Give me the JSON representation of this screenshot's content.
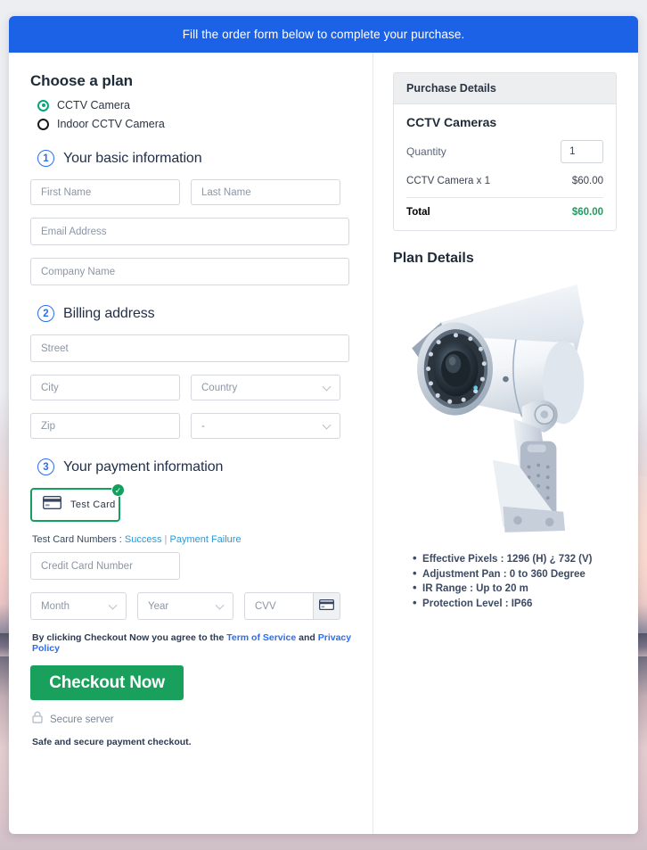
{
  "banner": {
    "text": "Fill the order form below to complete your purchase."
  },
  "plan": {
    "heading": "Choose a plan",
    "options": [
      {
        "label": "CCTV Camera",
        "selected": true
      },
      {
        "label": "Indoor CCTV Camera",
        "selected": false
      }
    ]
  },
  "steps": {
    "basic": {
      "number": "1",
      "title": "Your basic information"
    },
    "billing": {
      "number": "2",
      "title": "Billing address"
    },
    "payment": {
      "number": "3",
      "title": "Your payment information"
    }
  },
  "fields": {
    "first_name": {
      "placeholder": "First Name",
      "value": ""
    },
    "last_name": {
      "placeholder": "Last Name",
      "value": ""
    },
    "email": {
      "placeholder": "Email Address",
      "value": ""
    },
    "company": {
      "placeholder": "Company Name",
      "value": ""
    },
    "street": {
      "placeholder": "Street",
      "value": ""
    },
    "city": {
      "placeholder": "City",
      "value": ""
    },
    "country": {
      "placeholder": "Country",
      "value": ""
    },
    "zip": {
      "placeholder": "Zip",
      "value": ""
    },
    "state": {
      "placeholder": "-",
      "value": ""
    },
    "credit_card": {
      "placeholder": "Credit Card Number",
      "value": ""
    },
    "month": {
      "placeholder": "Month",
      "value": ""
    },
    "year": {
      "placeholder": "Year",
      "value": ""
    },
    "cvv": {
      "placeholder": "CVV",
      "value": ""
    }
  },
  "payment": {
    "tile_label": "Test  Card",
    "tile_selected": true,
    "tile_icon": "credit-card-icon",
    "tile_check": "✓",
    "test_cards_prefix": "Test Card Numbers : ",
    "test_card_success": "Success",
    "test_card_separator": " | ",
    "test_card_failure": "Payment Failure",
    "cvv_hint_icon": "credit-card-icon"
  },
  "terms": {
    "prefix": "By clicking Checkout Now you agree to the ",
    "link1": "Term of Service",
    "middle": " and ",
    "link2": "Privacy Policy"
  },
  "checkout": {
    "button_label": "Checkout Now",
    "secure_icon": "lock-icon",
    "secure_label": "Secure server",
    "safe_note": "Safe and secure payment checkout."
  },
  "purchase": {
    "header": "Purchase Details",
    "product": "CCTV Cameras",
    "quantity_label": "Quantity",
    "quantity_value": "1",
    "line_item_label": "CCTV Camera x 1",
    "line_item_amount": "$60.00",
    "total_label": "Total",
    "total_amount": "$60.00"
  },
  "plan_details": {
    "title": "Plan Details",
    "image_alt": "cctv-camera-photo",
    "specs": [
      "Effective Pixels : 1296 (H) ¿ 732 (V)",
      "Adjustment Pan : 0 to 360 Degree",
      "IR Range : Up to 20 m",
      "Protection Level : IP66"
    ]
  },
  "colors": {
    "banner_blue": "#1b62e6",
    "step_blue": "#2a6df0",
    "success_green": "#12a05f",
    "checkout_green": "#19a05c",
    "total_green": "#18a05c",
    "link_blue": "#2a9ad6"
  }
}
